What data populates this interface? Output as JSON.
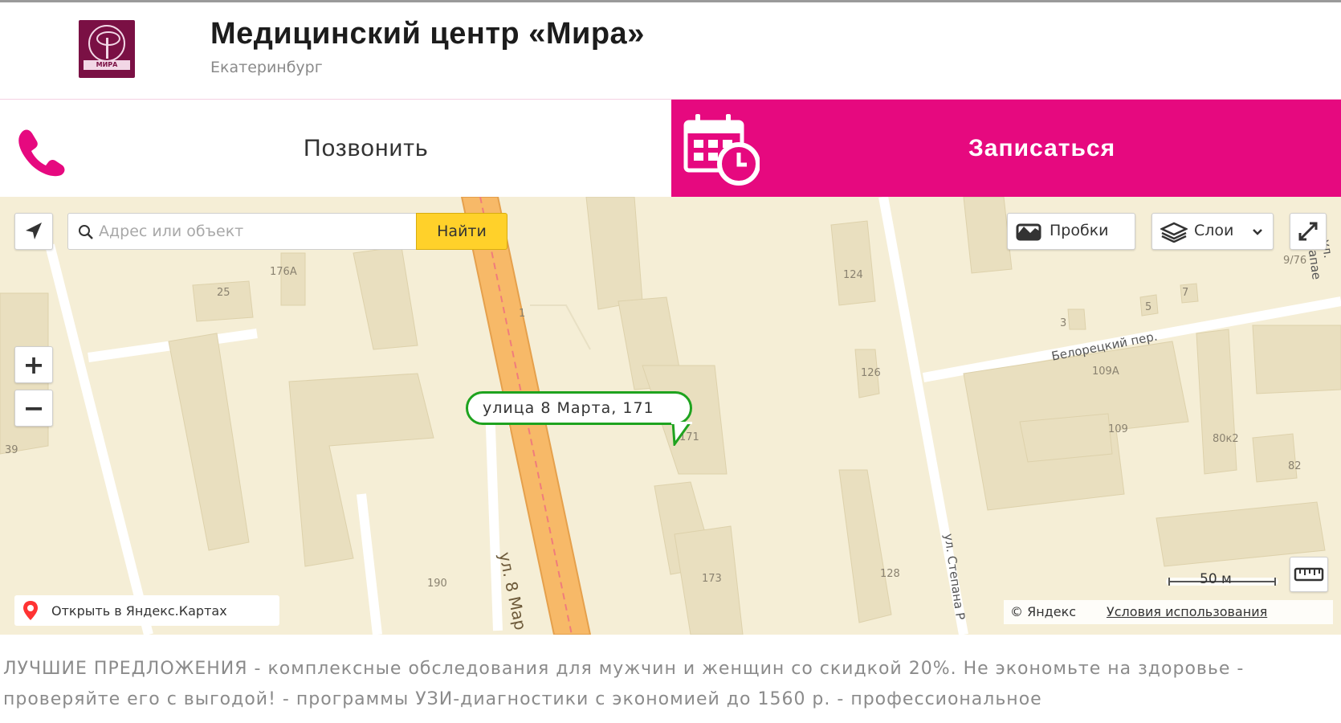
{
  "header": {
    "logo_text": "МИРА",
    "title": "Медицинский центр «Мира»",
    "city": "Екатеринбург"
  },
  "actions": {
    "call_label": "Позвонить",
    "book_label": "Записаться",
    "accent_color": "#e6097f"
  },
  "map": {
    "search_placeholder": "Адрес или объект",
    "search_value": "",
    "find_label": "Найти",
    "traffic_label": "Пробки",
    "layers_label": "Слои",
    "zoom_in_label": "+",
    "zoom_out_label": "−",
    "callout_address": "улица 8 Марта, 171",
    "open_in_yandex_label": "Открыть в Яндекс.Картах",
    "scale_label": "50 м",
    "copyright_brand": "© Яндекс",
    "terms_link": "Условия использования",
    "building_numbers": [
      "176А",
      "25",
      "39",
      "124",
      "126",
      "3",
      "5",
      "7",
      "9/76",
      "109А",
      "109",
      "80к2",
      "82",
      "171",
      "173",
      "128",
      "190",
      "1"
    ],
    "street_labels": {
      "march_8": "ул. 8 Мар",
      "belorechky": "Белорецкий пер.",
      "stepana": "ул. Степана Р",
      "chapaeva": "ул. Чапае"
    }
  },
  "description": {
    "text": "ЛУЧШИЕ ПРЕДЛОЖЕНИЯ - комплексные обследования для мужчин и женщин со скидкой 20%. Не экономьте на здоровье - проверяйте его с выгодой! - программы УЗИ-диагностики с экономией до 1560 р. - профессиональное"
  }
}
